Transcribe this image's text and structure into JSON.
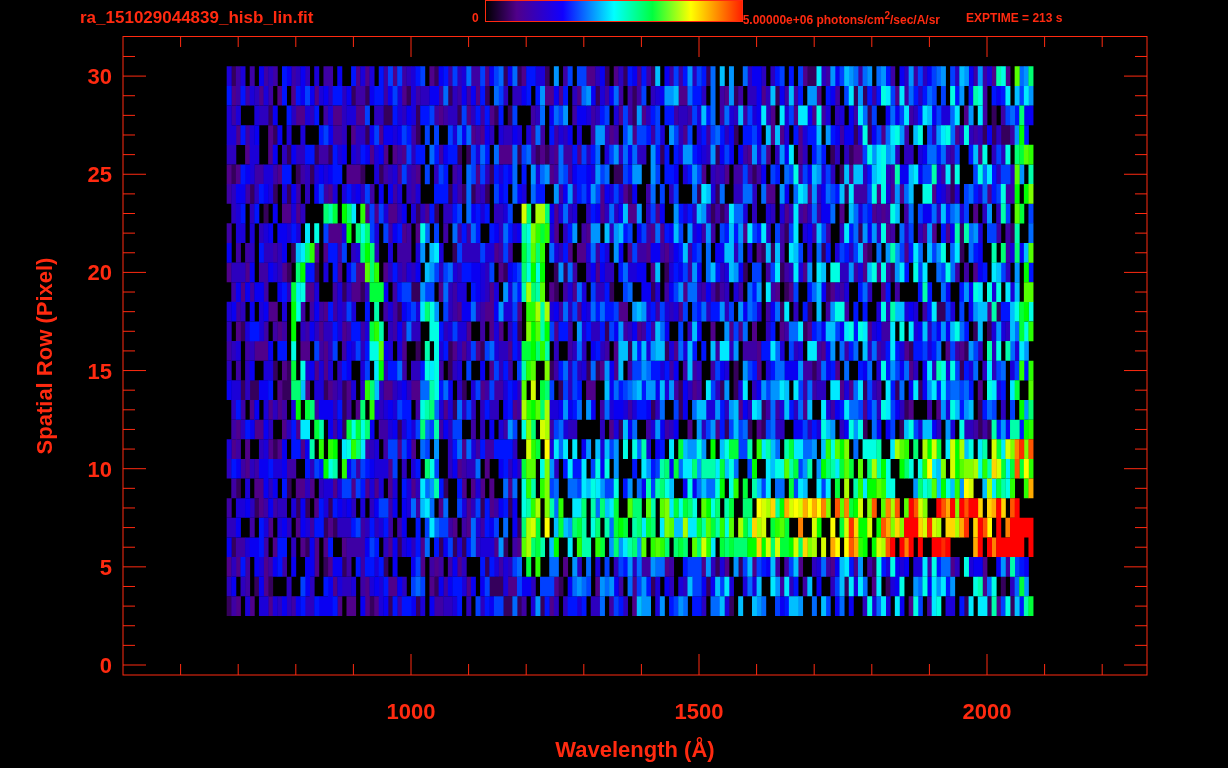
{
  "title": "ra_151029044839_hisb_lin.fit",
  "colorbar": {
    "min_label": "0",
    "max_label": "5.00000e+06 photons/cm$^{2}$/sec/A/sr"
  },
  "exptime": "EXPTIME = 213 s",
  "plot": {
    "xlabel": "Wavelength (Å)",
    "ylabel": "Spatial Row (Pixel)",
    "xticks": [
      "1000",
      "1500",
      "2000"
    ],
    "yticks": [
      "30",
      "25",
      "20",
      "15",
      "10",
      "5",
      "0"
    ]
  }
}
